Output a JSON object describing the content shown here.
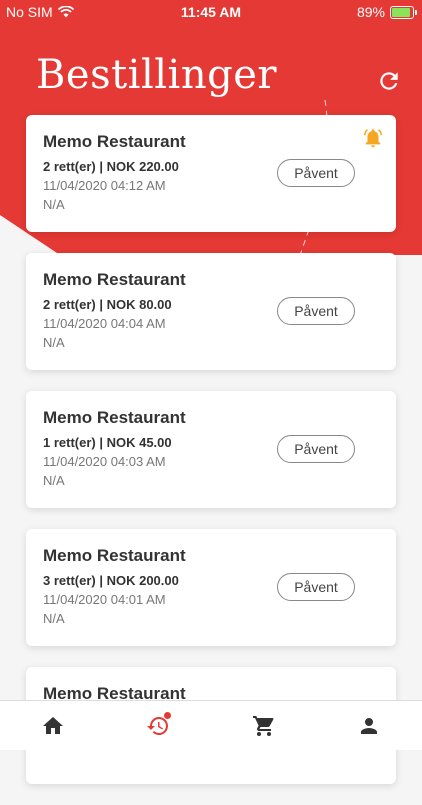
{
  "status_bar": {
    "carrier": "No SIM",
    "time": "11:45 AM",
    "battery": "89%",
    "battery_level": 0.89
  },
  "header": {
    "title": "Bestillinger",
    "bg_color": "#e53935"
  },
  "orders": [
    {
      "restaurant": "Memo Restaurant",
      "summary": "2 rett(er) | NOK 220.00",
      "date": "11/04/2020 04:12 AM",
      "note": "N/A",
      "button": "Påvent",
      "alert": true
    },
    {
      "restaurant": "Memo Restaurant",
      "summary": "2 rett(er) | NOK 80.00",
      "date": "11/04/2020 04:04 AM",
      "note": "N/A",
      "button": "Påvent"
    },
    {
      "restaurant": "Memo Restaurant",
      "summary": "1 rett(er) | NOK 45.00",
      "date": "11/04/2020 04:03 AM",
      "note": "N/A",
      "button": "Påvent"
    },
    {
      "restaurant": "Memo Restaurant",
      "summary": "3 rett(er) | NOK 200.00",
      "date": "11/04/2020 04:01 AM",
      "note": "N/A",
      "button": "Påvent"
    },
    {
      "restaurant": "Memo Restaurant"
    }
  ],
  "tabs": [
    {
      "icon": "home-icon"
    },
    {
      "icon": "history-icon",
      "active": true,
      "badge": true
    },
    {
      "icon": "cart-icon"
    },
    {
      "icon": "profile-icon"
    }
  ],
  "colors": {
    "accent": "#e53935",
    "alert": "#f5a623",
    "active_tab": "#e53935"
  }
}
